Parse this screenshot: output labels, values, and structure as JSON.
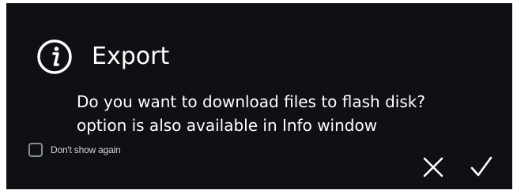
{
  "dialog": {
    "title": "Export",
    "message_line1": "Do you want to download files to flash disk?",
    "message_line2": "option is also available in Info window",
    "dont_show_label": "Don't show again",
    "dont_show_checked": false,
    "icons": {
      "info": "info-icon",
      "cancel": "close-icon",
      "confirm": "checkmark-icon"
    }
  },
  "colors": {
    "background": "#0e1013",
    "text": "#ffffff",
    "checkbox_border": "#8a8d92"
  }
}
